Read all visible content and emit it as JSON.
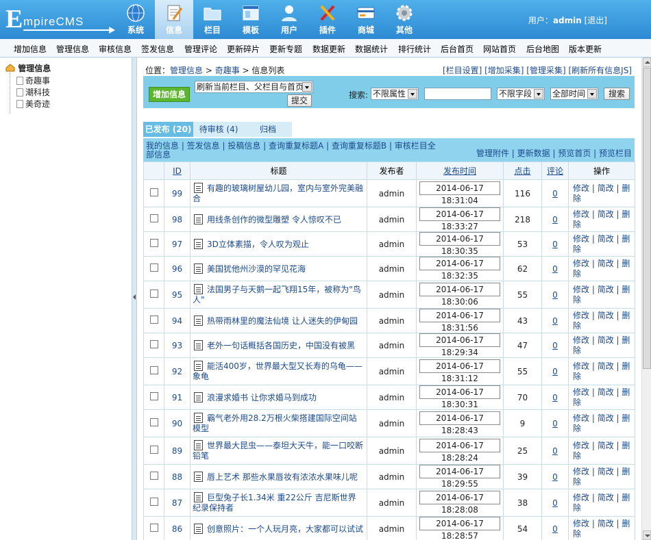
{
  "app": {
    "logo_letter": "E",
    "logo_rest": "mpireCMS"
  },
  "nav": [
    {
      "label": "系统",
      "icon": "globe-icon"
    },
    {
      "label": "信息",
      "icon": "edit-document-icon"
    },
    {
      "label": "栏目",
      "icon": "folder-icon"
    },
    {
      "label": "模板",
      "icon": "template-window-icon"
    },
    {
      "label": "用户",
      "icon": "user-icon"
    },
    {
      "label": "插件",
      "icon": "tools-icon"
    },
    {
      "label": "商城",
      "icon": "shop-card-icon"
    },
    {
      "label": "其他",
      "icon": "gear-icon"
    }
  ],
  "user": {
    "prefix": "用户：",
    "name": "admin",
    "logout": "[退出]"
  },
  "subbar": [
    "增加信息",
    "管理信息",
    "审核信息",
    "签发信息",
    "管理评论",
    "更新碎片",
    "更新专题",
    "数据更新",
    "数据统计",
    "排行统计",
    "后台首页",
    "网站首页",
    "后台地图",
    "版本更新"
  ],
  "tree": {
    "root": "管理信息",
    "items": [
      "奇趣事",
      "潮科技",
      "美奇迹"
    ]
  },
  "breadcrumb": {
    "prefix": "位置：",
    "p1": "管理信息",
    "sep": " > ",
    "p2": "奇趣事",
    "p3": "信息列表"
  },
  "toplinks": "[栏目设置] [增加采集] [管理采集] [刷新所有信息JS]",
  "filter": {
    "add_button": "增加信息",
    "refresh_select": "刷新当前栏目、父栏目与首页",
    "submit": "提交",
    "search_label": "搜索:",
    "attr_select": "不限属性",
    "field_select": "不限字段",
    "time_select": "全部时间",
    "search_button": "搜索"
  },
  "tabs": [
    "已发布 (20)",
    "待审核 (4)",
    "归档"
  ],
  "linkbar": {
    "left": "我的信息 | 签发信息 | 投稿信息 | 查询重复标题A | 查询重复标题B | 审核栏目全部信息",
    "right": "管理附件 | 更新数据 | 预览首页 | 预览栏目"
  },
  "table": {
    "headers": {
      "id": "ID",
      "title": "标题",
      "publisher": "发布者",
      "time": "发布时间",
      "clicks": "点击",
      "comments": "评论",
      "ops": "操作"
    },
    "ops": [
      "修改",
      "简改",
      "删除"
    ],
    "rows": [
      {
        "id": "99",
        "title": "有趣的玻璃树屋幼儿园，室内与室外完美融合",
        "publisher": "admin",
        "time": "2014-06-17 18:31:04",
        "clicks": "116",
        "comments": "0"
      },
      {
        "id": "98",
        "title": "用线条创作的微型雕塑 令人惊叹不已",
        "publisher": "admin",
        "time": "2014-06-17 18:33:27",
        "clicks": "218",
        "comments": "0"
      },
      {
        "id": "97",
        "title": "3D立体素描，令人叹为观止",
        "publisher": "admin",
        "time": "2014-06-17 18:30:35",
        "clicks": "53",
        "comments": "0"
      },
      {
        "id": "96",
        "title": "美国犹他州沙漠的罕见花海",
        "publisher": "admin",
        "time": "2014-06-17 18:32:35",
        "clicks": "62",
        "comments": "0"
      },
      {
        "id": "95",
        "title": "法国男子与天鹅一起飞翔15年，被称为\"鸟人\"",
        "publisher": "admin",
        "time": "2014-06-17 18:30:06",
        "clicks": "55",
        "comments": "0"
      },
      {
        "id": "94",
        "title": "热带雨林里的魔法仙境 让人迷失的伊甸园",
        "publisher": "admin",
        "time": "2014-06-17 18:31:56",
        "clicks": "43",
        "comments": "0"
      },
      {
        "id": "93",
        "title": "老外一句话概括各国历史，中国没有被黑",
        "publisher": "admin",
        "time": "2014-06-17 18:29:34",
        "clicks": "47",
        "comments": "0"
      },
      {
        "id": "92",
        "title": "能活400岁，世界最大型又长寿的乌龟——象龟",
        "publisher": "admin",
        "time": "2014-06-17 18:31:12",
        "clicks": "55",
        "comments": "0"
      },
      {
        "id": "91",
        "title": "浪漫求婚书 让你求婚马到成功",
        "publisher": "admin",
        "time": "2014-06-17 18:30:31",
        "clicks": "70",
        "comments": "0"
      },
      {
        "id": "90",
        "title": "霸气老外用28.2万根火柴搭建国际空间站模型",
        "publisher": "admin",
        "time": "2014-06-17 18:28:43",
        "clicks": "9",
        "comments": "0"
      },
      {
        "id": "89",
        "title": "世界最大昆虫——泰坦大天牛，能一口咬断铅笔",
        "publisher": "admin",
        "time": "2014-06-17 18:28:24",
        "clicks": "25",
        "comments": "0"
      },
      {
        "id": "88",
        "title": "唇上艺术 那些水果唇妆有浓浓水果味儿呢",
        "publisher": "admin",
        "time": "2014-06-17 18:29:55",
        "clicks": "39",
        "comments": "0"
      },
      {
        "id": "87",
        "title": "巨型兔子长1.34米 重22公斤 吉尼斯世界纪录保持者",
        "publisher": "admin",
        "time": "2014-06-17 18:28:08",
        "clicks": "38",
        "comments": "0"
      },
      {
        "id": "86",
        "title": "创意照片：一个人玩月亮，大家都可以试试",
        "publisher": "admin",
        "time": "2014-06-17 18:28:57",
        "clicks": "54",
        "comments": "0"
      }
    ]
  }
}
